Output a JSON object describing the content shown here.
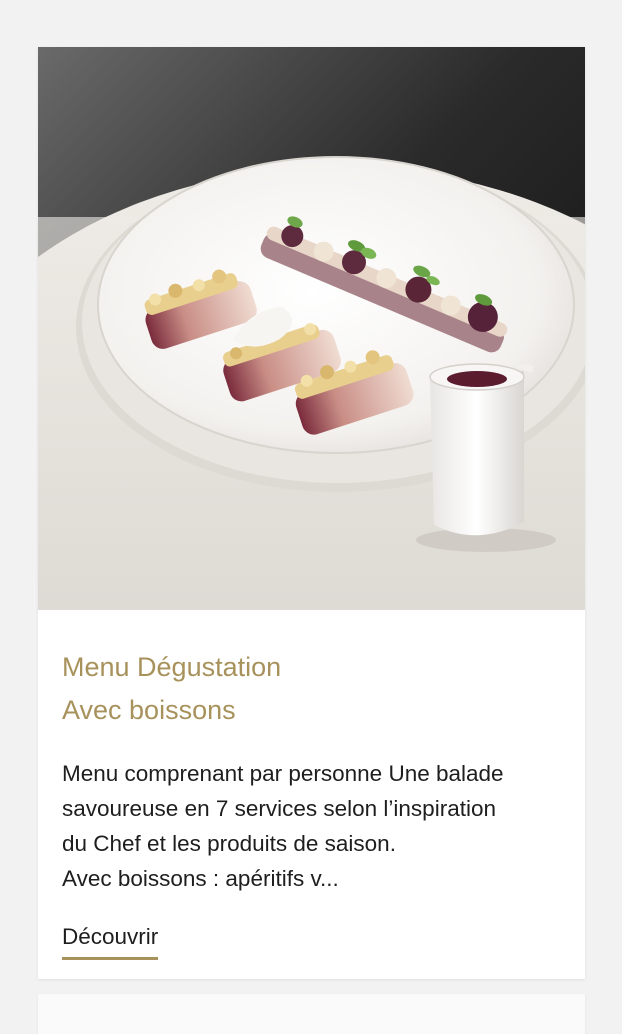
{
  "card": {
    "image_alt": "Assiette de dégustation",
    "title_line1": "Menu Dégustation",
    "title_line2": "Avec boissons",
    "description_lines": [
      "Menu comprenant par personne Une balade",
      "savoureuse en 7 services selon l’inspiration",
      "du Chef et les produits de saison.",
      "Avec boissons : apéritifs v..."
    ],
    "cta_label": "Découvrir"
  },
  "colors": {
    "accent": "#a8925c",
    "text": "#1e1e1e",
    "page_background": "#f2f2f2",
    "card_background": "#ffffff"
  }
}
